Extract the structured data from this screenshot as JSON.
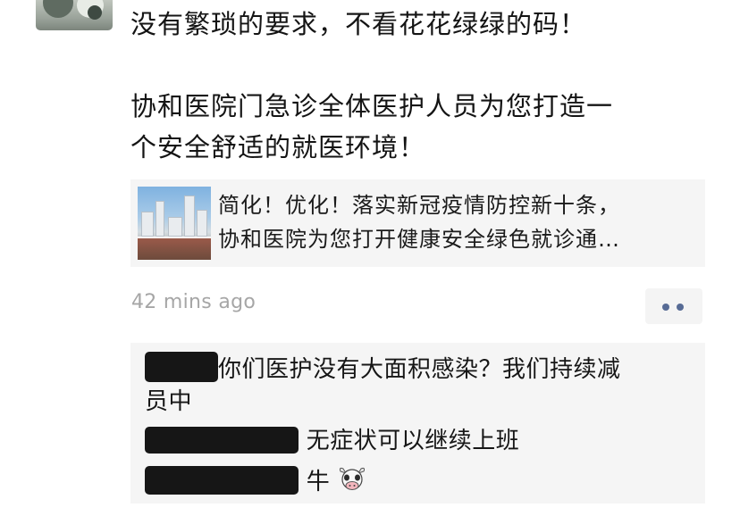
{
  "post": {
    "lines": [
      "没有繁琐的要求，不看花花绿绿的码！",
      "",
      "协和医院门急诊全体医护人员为您打造一",
      "个安全舒适的就医环境！"
    ]
  },
  "shared_link": {
    "title_line1": "简化！优化！落实新冠疫情防控新十条，",
    "title_line2": "协和医院为您打开健康安全绿色就诊通…"
  },
  "meta": {
    "timestamp": "42 mins ago",
    "more_icon": "ellipsis-icon",
    "more_color": "#576b95"
  },
  "comments": [
    {
      "text_line1": "你们医护没有大面积感染？我们持续减",
      "text_line2": "员中"
    },
    {
      "text": "无症状可以继续上班"
    },
    {
      "text": "牛",
      "emoji": "ox-face-icon"
    }
  ]
}
